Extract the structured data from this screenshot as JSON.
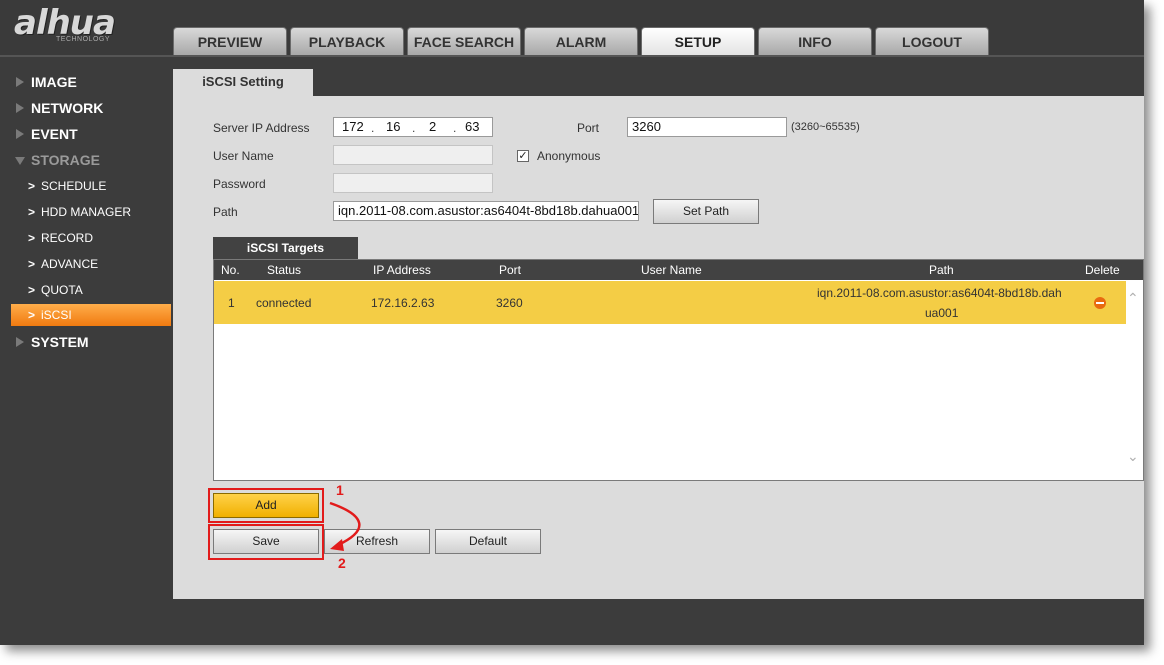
{
  "brand": {
    "logo": "alhua",
    "tagline": "TECHNOLOGY"
  },
  "tabs": [
    "PREVIEW",
    "PLAYBACK",
    "FACE SEARCH",
    "ALARM",
    "SETUP",
    "INFO",
    "LOGOUT"
  ],
  "active_tab": "SETUP",
  "sidebar": {
    "sections": [
      "IMAGE",
      "NETWORK",
      "EVENT",
      "STORAGE",
      "SYSTEM"
    ],
    "storage_items": [
      "SCHEDULE",
      "HDD MANAGER",
      "RECORD",
      "ADVANCE",
      "QUOTA",
      "iSCSI"
    ],
    "active_item": "iSCSI"
  },
  "panel": {
    "title": "iSCSI Setting",
    "server_ip_label": "Server IP Address",
    "server_ip": [
      "172",
      "16",
      "2",
      "63"
    ],
    "port_label": "Port",
    "port_value": "3260",
    "port_hint": "(3260~65535)",
    "username_label": "User Name",
    "anonymous_label": "Anonymous",
    "anonymous_checked": "✓",
    "password_label": "Password",
    "path_label": "Path",
    "path_value": "iqn.2011-08.com.asustor:as6404t-8bd18b.dahua001",
    "set_path_button": "Set Path"
  },
  "targets": {
    "title": "iSCSI Targets",
    "columns": [
      "No.",
      "Status",
      "IP Address",
      "Port",
      "User Name",
      "Path",
      "Delete"
    ],
    "rows": [
      {
        "no": "1",
        "status": "connected",
        "ip": "172.16.2.63",
        "port": "3260",
        "user": "",
        "path_line1": "iqn.2011-08.com.asustor:as6404t-8bd18b.dah",
        "path_line2": "ua001"
      }
    ]
  },
  "buttons": {
    "add": "Add",
    "save": "Save",
    "refresh": "Refresh",
    "default": "Default"
  },
  "annotations": {
    "step1": "1",
    "step2": "2",
    "color": "#e21b1b"
  }
}
